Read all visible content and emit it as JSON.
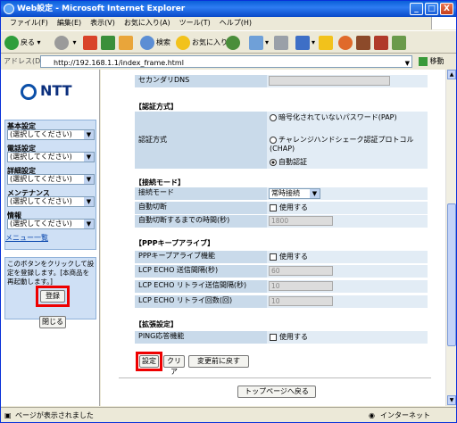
{
  "window": {
    "title": "Web設定 - Microsoft Internet Explorer",
    "min": "_",
    "max": "□",
    "close": "X"
  },
  "menu": [
    "ファイル(F)",
    "編集(E)",
    "表示(V)",
    "お気に入り(A)",
    "ツール(T)",
    "ヘルプ(H)"
  ],
  "toolbar": {
    "back": "戻る",
    "search": "検索",
    "favorites": "お気に入り"
  },
  "address": {
    "label": "アドレス(D)",
    "url": "http://192.168.1.1/index_frame.html",
    "go": "移動"
  },
  "left": {
    "logo": "NTT",
    "groups": [
      {
        "label": "基本設定",
        "value": "(選択してください)"
      },
      {
        "label": "電話設定",
        "value": "(選択してください)"
      },
      {
        "label": "詳細設定",
        "value": "(選択してください)"
      },
      {
        "label": "メンテナンス",
        "value": "(選択してください)"
      },
      {
        "label": "情報",
        "value": "(選択してください)"
      }
    ],
    "menu_link": "メニュー一覧",
    "save_note": "このボタンをクリックして設定を登録します。[本商品を再起動します。]",
    "save_button": "登録",
    "close_button": "閉じる"
  },
  "main": {
    "secondary_dns": "セカンダリDNS",
    "auth": {
      "section": "【認証方式】",
      "label": "認証方式",
      "opt1": "暗号化されていないパスワード(PAP)",
      "opt2": "チャレンジハンドシェーク認証プロトコル(CHAP)",
      "opt3": "自動認証"
    },
    "conn": {
      "section": "【接続モード】",
      "mode_label": "接続モード",
      "mode_value": "常時接続",
      "auto_cut": "自動切断",
      "use": "使用する",
      "auto_cut_time": "自動切断するまでの時間(秒)",
      "auto_cut_value": "1800"
    },
    "ppp": {
      "section": "【PPPキープアライブ】",
      "func": "PPPキープアライブ機能",
      "use": "使用する",
      "lcp_interval": "LCP ECHO 送信間隔(秒)",
      "lcp_interval_value": "60",
      "lcp_retry_interval": "LCP ECHO リトライ送信間隔(秒)",
      "lcp_retry_interval_value": "10",
      "lcp_retry_count": "LCP ECHO リトライ回数(回)",
      "lcp_retry_count_value": "10"
    },
    "ext": {
      "section": "【拡張設定】",
      "ping": "PING応答機能",
      "use": "使用する"
    },
    "buttons": {
      "set": "設定",
      "clear": "クリア",
      "revert": "変更前に戻す",
      "top": "トップページへ戻る"
    }
  },
  "status": {
    "left": "ページが表示されました",
    "right": "インターネット"
  }
}
